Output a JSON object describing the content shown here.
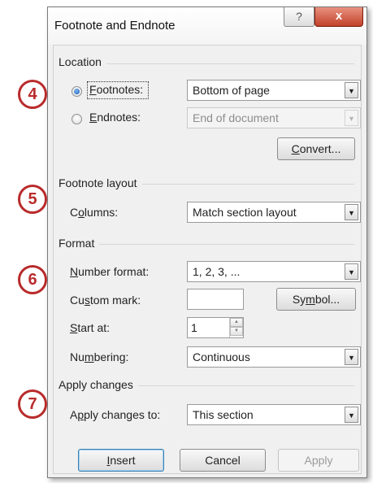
{
  "dialog": {
    "title": "Footnote and Endnote",
    "help_glyph": "?",
    "close_glyph": "x"
  },
  "location": {
    "group_title": "Location",
    "footnotes": {
      "label_key": "F",
      "label_rest": "ootnotes:",
      "selected": true,
      "value": "Bottom of page"
    },
    "endnotes": {
      "label_key": "E",
      "label_rest": "ndnotes:",
      "selected": false,
      "value": "End of document"
    },
    "convert": {
      "pre": "",
      "key": "C",
      "rest": "onvert..."
    }
  },
  "footnote_layout": {
    "group_title": "Footnote layout",
    "columns": {
      "pre": "C",
      "key": "o",
      "rest": "lumns:",
      "value": "Match section layout"
    }
  },
  "format": {
    "group_title": "Format",
    "number_format": {
      "pre": "",
      "key": "N",
      "rest": "umber format:",
      "value": "1, 2, 3, ..."
    },
    "custom_mark": {
      "pre": "Cu",
      "key": "s",
      "rest": "tom mark:",
      "value": ""
    },
    "symbol": {
      "pre": "Sy",
      "key": "m",
      "rest": "bol..."
    },
    "start_at": {
      "pre": "",
      "key": "S",
      "rest": "tart at:",
      "value": "1"
    },
    "numbering": {
      "pre": "Nu",
      "key": "m",
      "rest": "bering:",
      "value": "Continuous"
    }
  },
  "apply_changes": {
    "group_title": "Apply changes",
    "apply_to": {
      "pre": "A",
      "key": "p",
      "rest": "ply changes to:",
      "value": "This section"
    }
  },
  "buttons": {
    "insert": {
      "pre": "",
      "key": "I",
      "rest": "nsert"
    },
    "cancel": "Cancel",
    "apply": "Apply"
  },
  "callouts": [
    "4",
    "5",
    "6",
    "7"
  ],
  "colors": {
    "callout": "#b92b2b",
    "close_button": "#c2412a",
    "radio_selected": "#1c5fbd"
  }
}
